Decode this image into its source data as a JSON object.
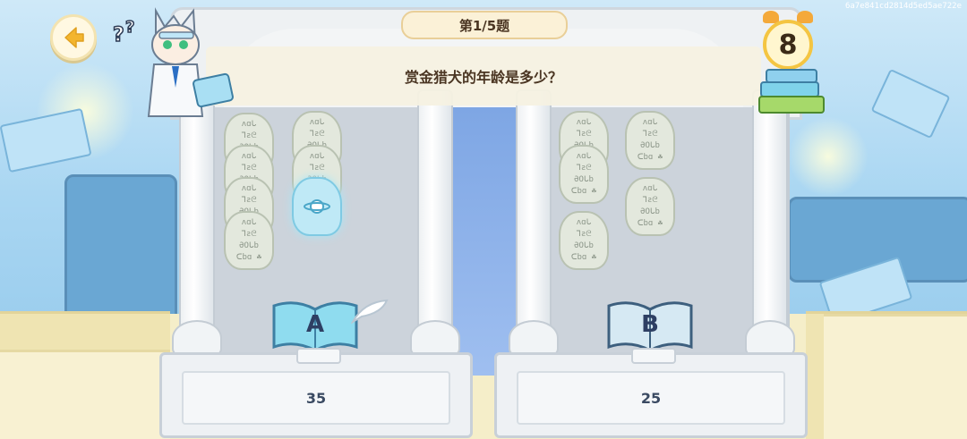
{
  "device_hash": "6a7e841cd2814d5ed5ae722e",
  "header": {
    "progress_label": "第1/5题",
    "question": "赏金猎犬的年龄是多少？"
  },
  "timer": {
    "seconds_left": "8"
  },
  "options": [
    {
      "letter": "A",
      "answer": "35"
    },
    {
      "letter": "B",
      "answer": "25"
    }
  ],
  "tablet_glyphs": [
    "ʌɑᒐ",
    "ᒣƨᘓ",
    "ƏOᒐb",
    "ᑕbɑ ☘"
  ],
  "icons": {
    "back": "back-arrow-icon",
    "timer": "alarm-clock-icon",
    "character": "cat-scientist-character",
    "books": "book-stack-icon"
  },
  "colors": {
    "accent_yellow": "#f4c542",
    "text_dark": "#4a3522",
    "option_book": "#7fd3ea"
  }
}
